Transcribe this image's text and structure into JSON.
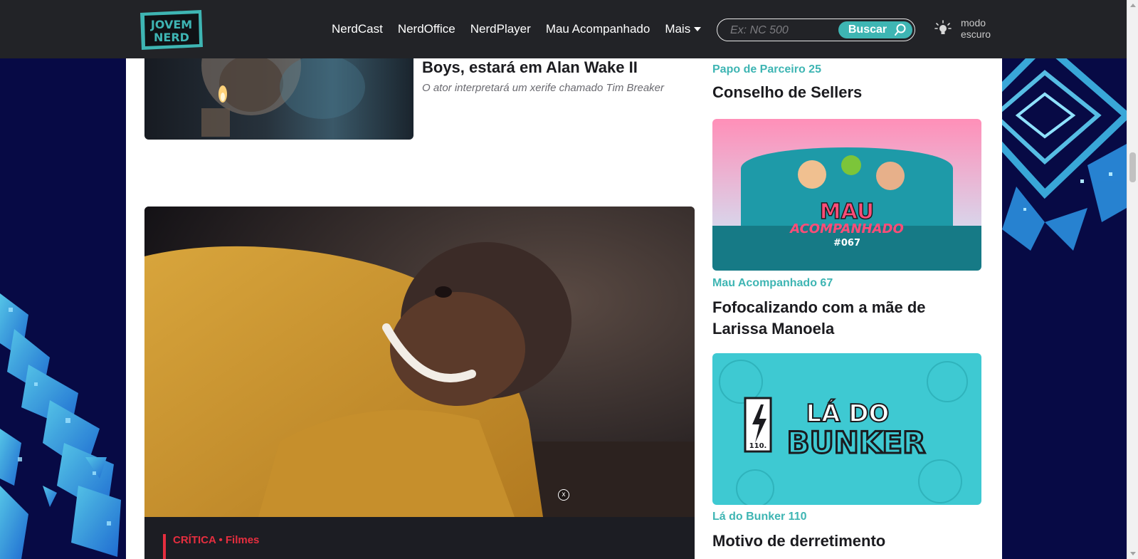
{
  "header": {
    "logo_text": "JOVEM NERD",
    "nav": [
      {
        "label": "NerdCast"
      },
      {
        "label": "NerdOffice"
      },
      {
        "label": "NerdPlayer"
      },
      {
        "label": "Mau Acompanhado"
      }
    ],
    "more_label": "Mais",
    "search": {
      "placeholder": "Ex: NC 500",
      "button_label": "Buscar"
    },
    "darkmode_label_1": "modo",
    "darkmode_label_2": "escuro"
  },
  "articles": {
    "top": {
      "title": "Boys, estará em Alan Wake II",
      "description": "O ator interpretará um xerife chamado Tim Breaker"
    },
    "feature": {
      "category": "CRÍTICA • Filmes",
      "close_symbol": "x"
    }
  },
  "sidebar": {
    "items": [
      {
        "category": "Papo de Parceiro 25",
        "title": "Conselho de Sellers"
      },
      {
        "category": "Mau Acompanhado 67",
        "title": "Fofocalizando com a mãe de Larissa Manoela",
        "card_text": "MAU",
        "card_subtext": "ACOMPANHADO",
        "card_number": "#067"
      },
      {
        "category": "Lá do Bunker 110",
        "title": "Motivo de derretimento",
        "card_text_1": "LÁ DO",
        "card_text_2": "BUNKER",
        "card_number": "110."
      }
    ]
  },
  "colors": {
    "header_bg": "#222327",
    "accent_teal": "#3eb5b3",
    "accent_red": "#e62e3f",
    "side_bg": "#070a45"
  }
}
